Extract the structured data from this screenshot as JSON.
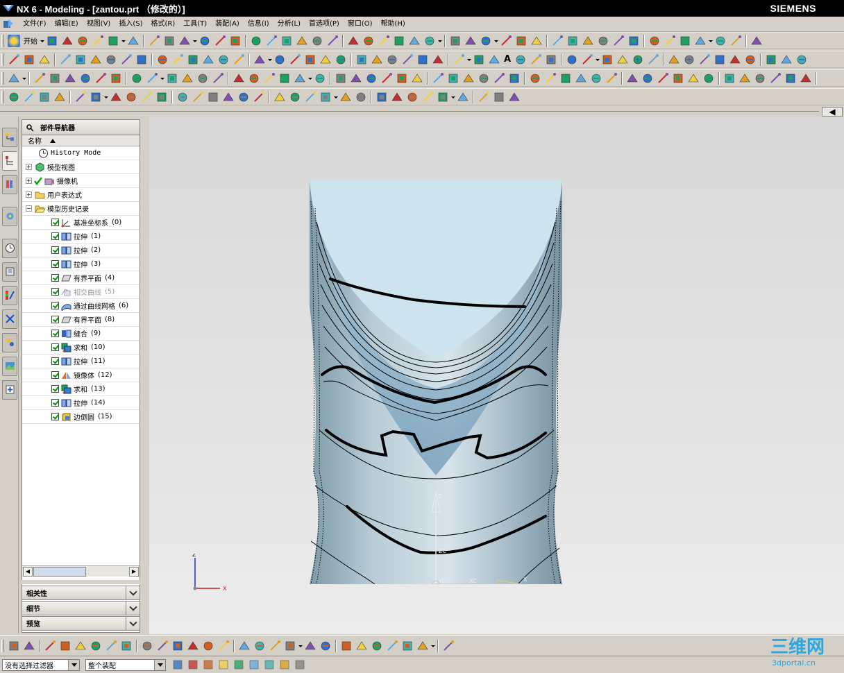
{
  "window": {
    "title": "NX 6 - Modeling - [zantou.prt （修改的）]",
    "brand": "SIEMENS"
  },
  "menu": [
    "文件(F)",
    "编辑(E)",
    "视图(V)",
    "插入(S)",
    "格式(R)",
    "工具(T)",
    "装配(A)",
    "信息(I)",
    "分析(L)",
    "首选项(P)",
    "窗口(O)",
    "帮助(H)"
  ],
  "toolbar": {
    "start_label": "开始",
    "text_tool": "A"
  },
  "navigator": {
    "title": "部件导航器",
    "column_name": "名称",
    "top_items": [
      {
        "label": "History Mode",
        "icon": "clock-icon"
      },
      {
        "label": "模型视图",
        "icon": "model-views-icon"
      },
      {
        "label": "摄像机",
        "icon": "camera-icon"
      },
      {
        "label": "用户表达式",
        "icon": "folder-icon"
      },
      {
        "label": "模型历史记录",
        "icon": "folder-open-icon"
      }
    ],
    "features": [
      {
        "name": "基准坐标系",
        "index": "(0)",
        "icon": "datum-csys-icon",
        "dim": false
      },
      {
        "name": "拉伸",
        "index": "(1)",
        "icon": "extrude-icon",
        "dim": false
      },
      {
        "name": "拉伸",
        "index": "(2)",
        "icon": "extrude-icon",
        "dim": false
      },
      {
        "name": "拉伸",
        "index": "(3)",
        "icon": "extrude-icon",
        "dim": false
      },
      {
        "name": "有界平面",
        "index": "(4)",
        "icon": "bounded-plane-icon",
        "dim": false
      },
      {
        "name": "相交曲线",
        "index": "(5)",
        "icon": "intersection-curve-icon",
        "dim": true
      },
      {
        "name": "通过曲线网格",
        "index": "(6)",
        "icon": "curve-mesh-icon",
        "dim": false
      },
      {
        "name": "有界平面",
        "index": "(8)",
        "icon": "bounded-plane-icon",
        "dim": false
      },
      {
        "name": "缝合",
        "index": "(9)",
        "icon": "sew-icon",
        "dim": false
      },
      {
        "name": "求和",
        "index": "(10)",
        "icon": "unite-icon",
        "dim": false
      },
      {
        "name": "拉伸",
        "index": "(11)",
        "icon": "extrude-icon",
        "dim": false
      },
      {
        "name": "镜像体",
        "index": "(12)",
        "icon": "mirror-body-icon",
        "dim": false
      },
      {
        "name": "求和",
        "index": "(13)",
        "icon": "unite-icon",
        "dim": false
      },
      {
        "name": "拉伸",
        "index": "(14)",
        "icon": "extrude-icon",
        "dim": false
      },
      {
        "name": "边倒圆",
        "index": "(15)",
        "icon": "edge-blend-icon",
        "dim": false
      }
    ],
    "panels": [
      "相关性",
      "细节",
      "预览"
    ]
  },
  "viewport": {
    "axis_labels": {
      "wcs_z": "Z",
      "wcs_x": "X",
      "triad_z": "Z",
      "triad_x": "X",
      "zc": "ZC",
      "xc": "XC",
      "yc": "YC"
    }
  },
  "status": {
    "filter": "没有选择过滤器",
    "scope": "整个装配"
  },
  "watermark": {
    "text": "三维网",
    "url": "3dportal.cn"
  },
  "colors": {
    "model_surface": "#a8c4d4",
    "model_top": "#cce4ee",
    "viewport_bg": "#dcdcdc"
  }
}
